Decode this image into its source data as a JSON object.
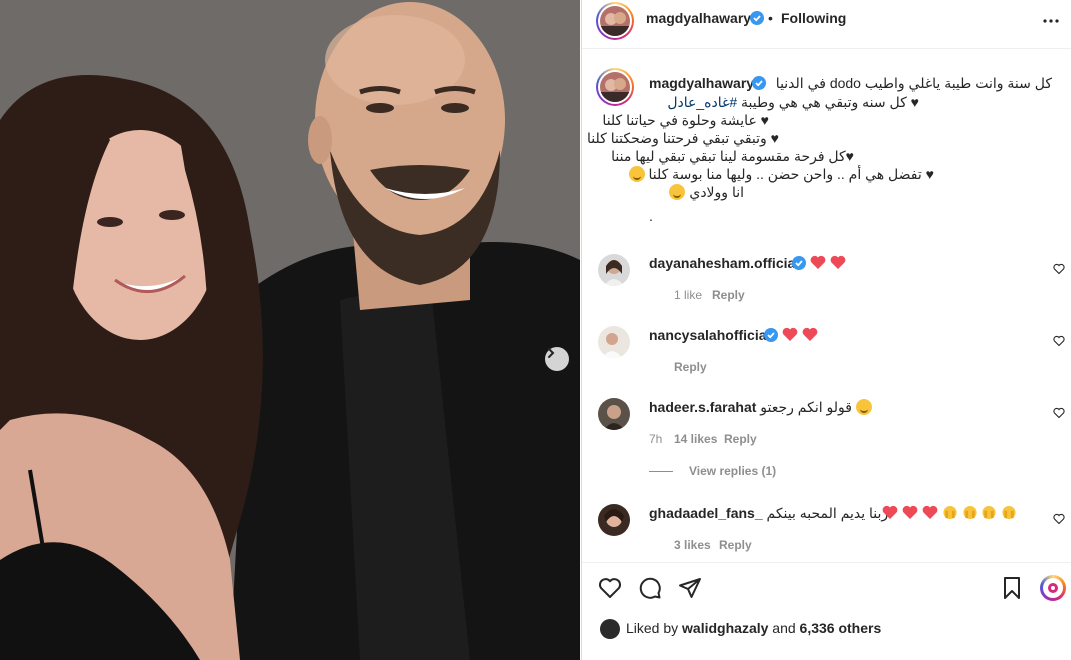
{
  "post": {
    "username": "magdyalhawary",
    "follow_status": "Following",
    "separator": "•"
  },
  "caption": {
    "username": "magdyalhawary",
    "line1": "كل سنة وانت طيبة ياغلي واطيب dodo في الدنيا",
    "line2_a": "#غاده_عادل",
    "line2_b": "♥ كل سنه وتبقي هي هي وطيبة",
    "line3": "♥ عايشة وحلوة في حياتنا كلنا",
    "line4": "♥ وتبقي تبقي فرحتنا وضحكتنا كلنا",
    "line5": "♥كل فرحة مقسومة لينا تبقي تبقي ليها مننا",
    "line6": "♥ تفضل هي أم .. واحن حضن .. وليها منا بوسة كلنا",
    "line7": "انا وولادي",
    "line8": "."
  },
  "comments": [
    {
      "user": "dayanahesham.official",
      "verified": true,
      "text": "",
      "likes": "1 like",
      "reply": "Reply",
      "time": ""
    },
    {
      "user": "nancysalahofficial",
      "verified": true,
      "text": "",
      "likes": "",
      "reply": "Reply",
      "time": ""
    },
    {
      "user": "hadeer.s.farahat",
      "verified": false,
      "text": "قولو انكم رجعتو",
      "likes": "14 likes",
      "reply": "Reply",
      "time": "7h"
    },
    {
      "user": "ghadaadel_fans_",
      "verified": false,
      "text": "ربنا يديم المحبه بينكم",
      "likes": "3 likes",
      "reply": "Reply",
      "time": ""
    }
  ],
  "view_replies": "View replies (1)",
  "likes_bar": {
    "prefix": "Liked by",
    "liker": "walidghazaly",
    "middle": "and",
    "count": "6,336 others"
  },
  "icons": {
    "verified": "verified-badge-icon",
    "more": "more-horizontal-icon",
    "like": "heart-outline-icon",
    "comment": "comment-bubble-icon",
    "share": "paper-plane-icon",
    "save": "bookmark-icon",
    "next": "chevron-right-icon"
  },
  "colors": {
    "verified_blue": "#3897f0",
    "text": "#262626",
    "muted": "#8e8e8e",
    "heart_red": "#ed4956",
    "hashtag": "#00376b"
  }
}
